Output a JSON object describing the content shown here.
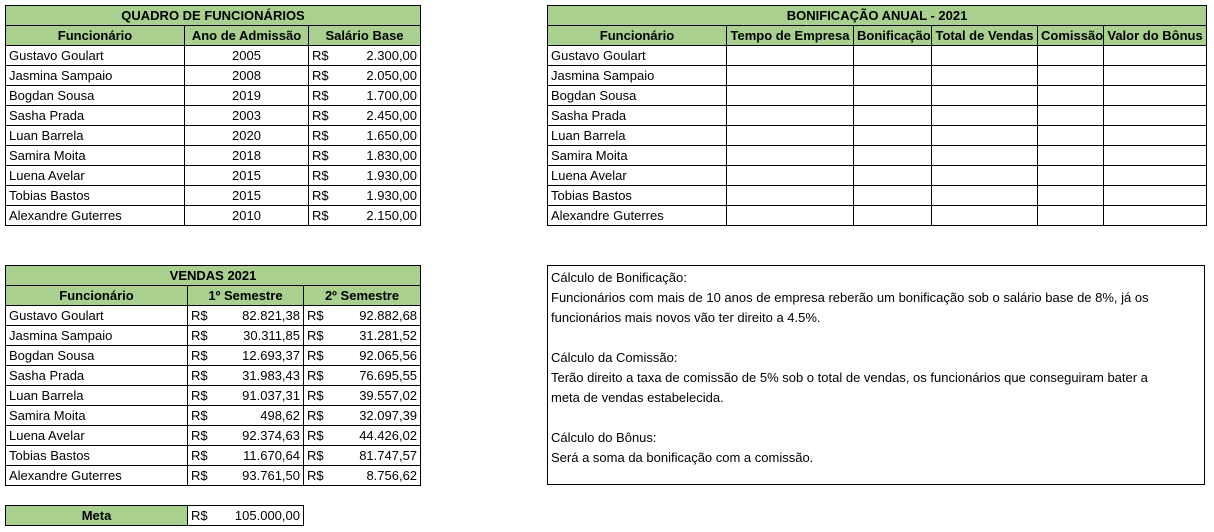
{
  "employees": {
    "title": "QUADRO DE FUNCIONÁRIOS",
    "headers": [
      "Funcionário",
      "Ano de Admissão",
      "Salário Base"
    ],
    "currency": "R$",
    "rows": [
      {
        "name": "Gustavo Goulart",
        "year": "2005",
        "salary": "2.300,00"
      },
      {
        "name": "Jasmina Sampaio",
        "year": "2008",
        "salary": "2.050,00"
      },
      {
        "name": "Bogdan Sousa",
        "year": "2019",
        "salary": "1.700,00"
      },
      {
        "name": "Sasha Prada",
        "year": "2003",
        "salary": "2.450,00"
      },
      {
        "name": "Luan Barrela",
        "year": "2020",
        "salary": "1.650,00"
      },
      {
        "name": "Samira Moita",
        "year": "2018",
        "salary": "1.830,00"
      },
      {
        "name": "Luena Avelar",
        "year": "2015",
        "salary": "1.930,00"
      },
      {
        "name": "Tobias Bastos",
        "year": "2015",
        "salary": "1.930,00"
      },
      {
        "name": "Alexandre Guterres",
        "year": "2010",
        "salary": "2.150,00"
      }
    ]
  },
  "bonus": {
    "title": "BONIFICAÇÃO ANUAL - 2021",
    "headers": [
      "Funcionário",
      "Tempo de Empresa",
      "Bonificação",
      "Total de Vendas",
      "Comissão",
      "Valor do Bônus"
    ],
    "rows": [
      "Gustavo Goulart",
      "Jasmina Sampaio",
      "Bogdan Sousa",
      "Sasha Prada",
      "Luan Barrela",
      "Samira Moita",
      "Luena Avelar",
      "Tobias Bastos",
      "Alexandre Guterres"
    ]
  },
  "sales": {
    "title": "VENDAS 2021",
    "headers": [
      "Funcionário",
      "1º Semestre",
      "2º Semestre"
    ],
    "currency": "R$",
    "rows": [
      {
        "name": "Gustavo Goulart",
        "s1": "82.821,38",
        "s2": "92.882,68"
      },
      {
        "name": "Jasmina Sampaio",
        "s1": "30.311,85",
        "s2": "31.281,52"
      },
      {
        "name": "Bogdan Sousa",
        "s1": "12.693,37",
        "s2": "92.065,56"
      },
      {
        "name": "Sasha Prada",
        "s1": "31.983,43",
        "s2": "76.695,55"
      },
      {
        "name": "Luan Barrela",
        "s1": "91.037,31",
        "s2": "39.557,02"
      },
      {
        "name": "Samira Moita",
        "s1": "498,62",
        "s2": "32.097,39"
      },
      {
        "name": "Luena Avelar",
        "s1": "92.374,63",
        "s2": "44.426,02"
      },
      {
        "name": "Tobias Bastos",
        "s1": "11.670,64",
        "s2": "81.747,57"
      },
      {
        "name": "Alexandre Guterres",
        "s1": "93.761,50",
        "s2": "8.756,62"
      }
    ]
  },
  "meta": {
    "label": "Meta",
    "currency": "R$",
    "value": "105.000,00"
  },
  "notes": [
    "Cálculo de Bonificação:",
    "Funcionários com mais de 10 anos de empresa reberão um bonificação sob o salário base de 8%, já os",
    "funcionários mais novos vão ter direito a 4.5%.",
    "",
    "Cálculo da Comissão:",
    "Terão direito a taxa de comissão de 5% sob o total de vendas, os funcionários que conseguiram bater a",
    "meta de vendas estabelecida.",
    "",
    "Cálculo do Bônus:",
    "Será a soma da bonificação com a comissão."
  ]
}
